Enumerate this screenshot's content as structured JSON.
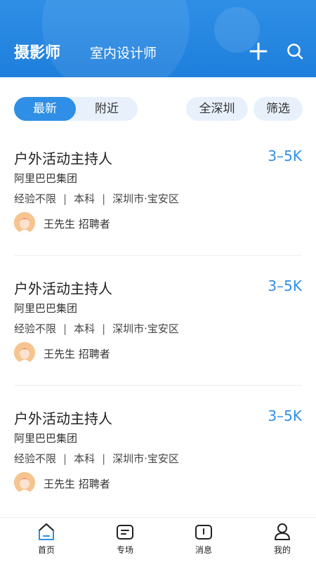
{
  "header": {
    "tab_active": "摄影师",
    "tab_secondary": "室内设计师"
  },
  "filters": {
    "latest": "最新",
    "nearby": "附近",
    "city": "全深圳",
    "filter": "筛选"
  },
  "jobs": [
    {
      "title": "户外活动主持人",
      "salary": "3–5K",
      "company": "阿里巴巴集团",
      "experience": "经验不限",
      "education": "本科",
      "location": "深圳市·宝安区",
      "recruiter": "王先生 招聘者"
    },
    {
      "title": "户外活动主持人",
      "salary": "3–5K",
      "company": "阿里巴巴集团",
      "experience": "经验不限",
      "education": "本科",
      "location": "深圳市·宝安区",
      "recruiter": "王先生 招聘者"
    },
    {
      "title": "户外活动主持人",
      "salary": "3–5K",
      "company": "阿里巴巴集团",
      "experience": "经验不限",
      "education": "本科",
      "location": "深圳市·宝安区",
      "recruiter": "王先生 招聘者"
    }
  ],
  "nav": {
    "home": "首页",
    "topics": "专场",
    "messages": "消息",
    "mine": "我的"
  },
  "colors": {
    "accent": "#2f8fe6",
    "pill_bg": "#e8f1fb"
  },
  "icons": {
    "add": "plus-icon",
    "search": "search-icon",
    "home": "home-icon",
    "topics": "list-icon",
    "messages": "message-icon",
    "mine": "user-icon"
  }
}
